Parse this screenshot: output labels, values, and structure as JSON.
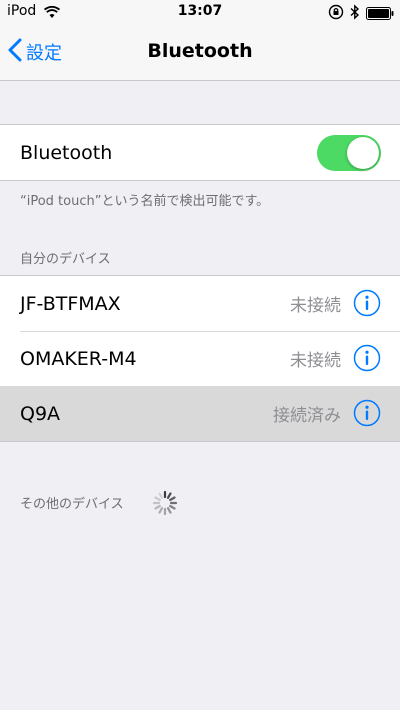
{
  "status_bar": {
    "carrier": "iPod",
    "time": "13:07"
  },
  "nav": {
    "back_label": "設定",
    "title": "Bluetooth"
  },
  "bluetooth_toggle": {
    "label": "Bluetooth",
    "on": true,
    "color": "#4cd964"
  },
  "discoverable_text": "“iPod touch”という名前で検出可能です。",
  "my_devices": {
    "header": "自分のデバイス",
    "items": [
      {
        "name": "JF-BTFMAX",
        "status": "未接続"
      },
      {
        "name": "OMAKER-M4",
        "status": "未接続"
      },
      {
        "name": "Q9A",
        "status": "接続済み"
      }
    ]
  },
  "other_devices": {
    "header": "その他のデバイス"
  },
  "colors": {
    "accent": "#007aff",
    "background": "#efeff4",
    "selected_row": "#d9d9d9"
  },
  "icons": {
    "wifi": "wifi-icon",
    "info": "info-icon",
    "back": "chevron-left-icon",
    "spinner": "activity-spinner-icon"
  }
}
